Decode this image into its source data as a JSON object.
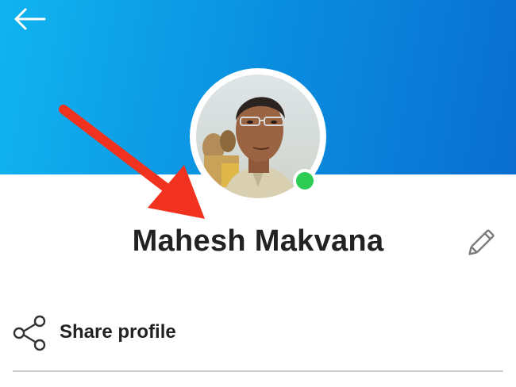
{
  "header": {
    "back_icon": "arrow-left-icon",
    "gradient_colors": [
      "#11b4ef",
      "#0a6ed1"
    ]
  },
  "profile": {
    "name": "Mahesh Makvana",
    "status": "online",
    "status_color": "#2ecc55"
  },
  "actions": {
    "edit_icon": "pencil-icon",
    "share_icon": "share-icon",
    "share_label": "Share profile"
  },
  "annotation": {
    "type": "red-arrow",
    "color": "#f0321e"
  }
}
